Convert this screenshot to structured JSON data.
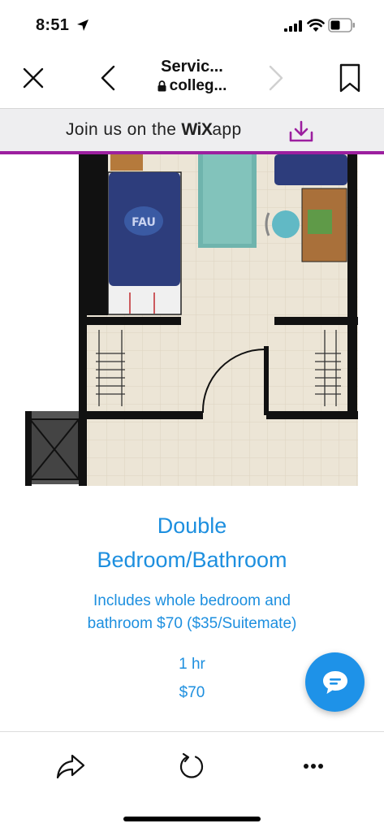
{
  "status_bar": {
    "time": "8:51",
    "icons": [
      "location-arrow-icon",
      "cellular-signal-icon",
      "wifi-icon",
      "battery-icon"
    ]
  },
  "nav": {
    "title": "Servic...",
    "subtitle": "colleg...",
    "icons": [
      "close-icon",
      "back-icon",
      "forward-icon",
      "lock-icon",
      "bookmark-icon"
    ]
  },
  "wix_banner": {
    "prefix": "Join us on the",
    "logo": "WiX",
    "suffix": "app",
    "accent_color": "#9c1f9f",
    "icon": "download-icon"
  },
  "service": {
    "name_line1": "Double",
    "name_line2": "Bedroom/Bathroom",
    "description_line1": "Includes whole bedroom and",
    "description_line2": "bathroom $70 ($35/Suitemate)",
    "duration": "1 hr",
    "price": "$70",
    "text_color": "#1d8fdf"
  },
  "chat_fab": {
    "icon": "chat-bubble-icon",
    "color": "#1e92e8"
  },
  "bottom_bar": {
    "icons": [
      "share-icon",
      "reload-icon",
      "more-icon"
    ]
  }
}
